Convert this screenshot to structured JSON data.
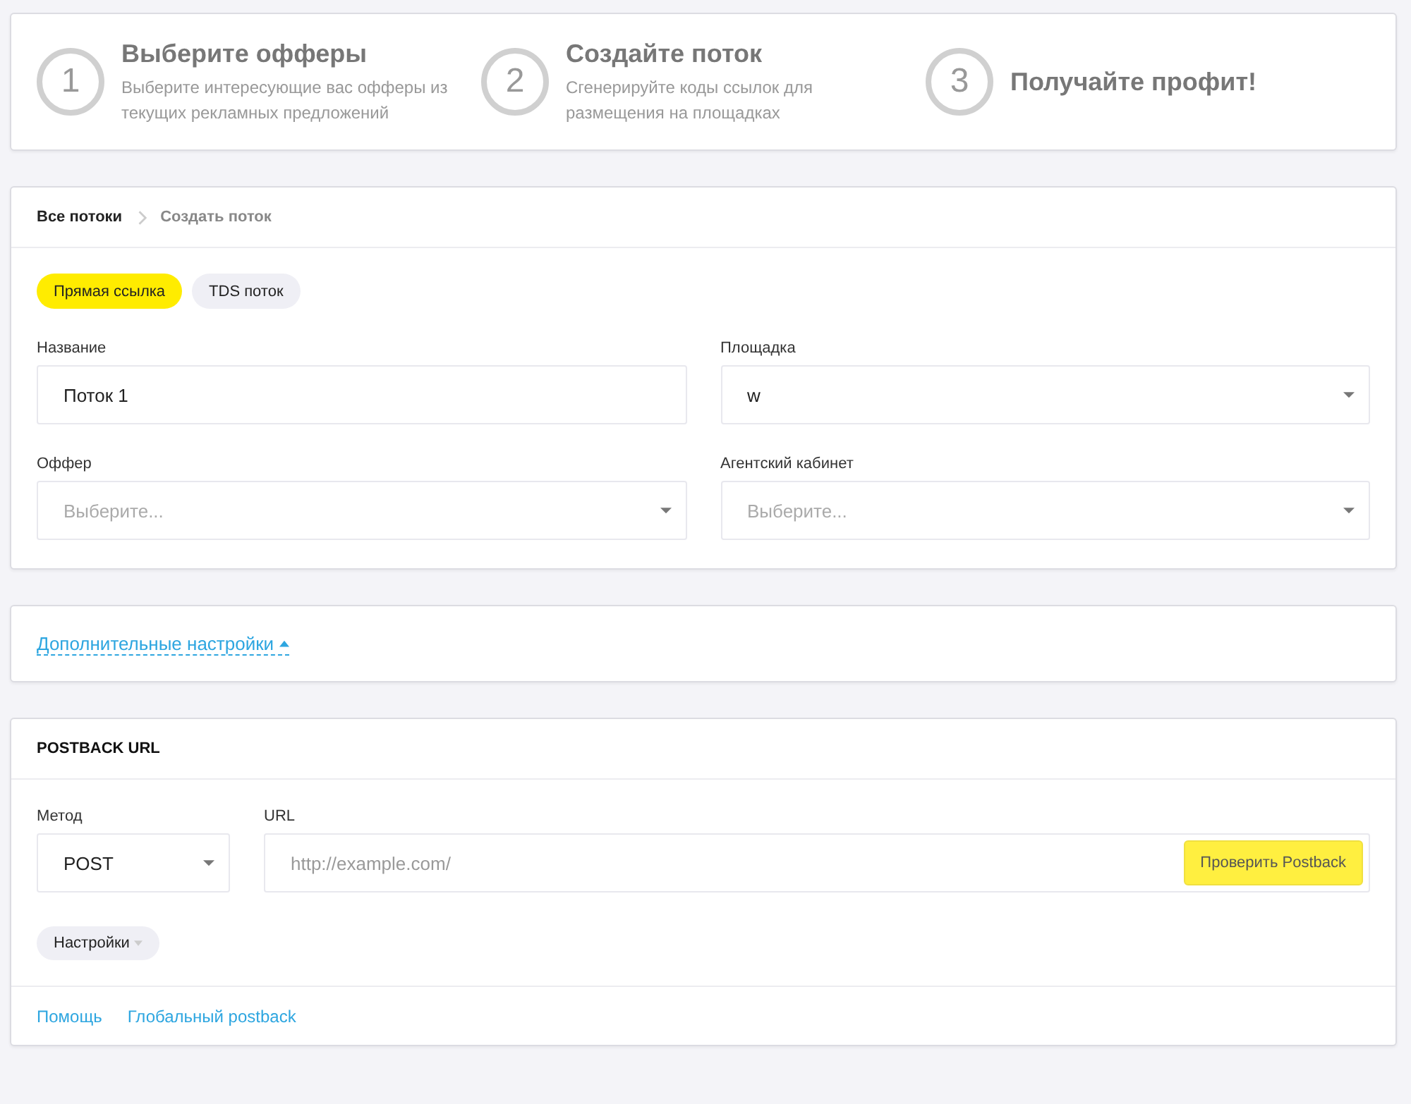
{
  "steps": [
    {
      "number": "1",
      "title": "Выберите офферы",
      "description": "Выберите интересующие вас офферы из текущих рекламных предложений"
    },
    {
      "number": "2",
      "title": "Создайте поток",
      "description": "Сгенерируйте коды ссылок для размещения на площадках"
    },
    {
      "number": "3",
      "title": "Получайте профит!"
    }
  ],
  "breadcrumbs": [
    {
      "label": "Все потоки",
      "selected": false
    },
    {
      "label": "Создать поток",
      "selected": true
    }
  ],
  "flow_types": [
    {
      "label": "Прямая ссылка",
      "selected": true
    },
    {
      "label": "TDS поток",
      "selected": false
    }
  ],
  "fields": [
    {
      "kind": "text",
      "label": "Название",
      "value": "Поток 1"
    },
    {
      "kind": "select",
      "label": "Площадка",
      "value": "w"
    },
    {
      "kind": "select",
      "label": "Оффер",
      "placeholder": "Выберите..."
    },
    {
      "kind": "select",
      "label": "Агентский кабинет",
      "placeholder": "Выберите..."
    }
  ],
  "advanced_settings": {
    "label": "Дополнительные настройки",
    "expanded": true
  },
  "postback": {
    "title": "POSTBACK URL",
    "method_label": "Метод",
    "method": "POST",
    "url_label": "URL",
    "url_placeholder": "http://example.com/",
    "check_button": "Проверить Postback",
    "settings_button": "Настройки",
    "links": [
      "Помощь",
      "Глобальный postback"
    ]
  }
}
